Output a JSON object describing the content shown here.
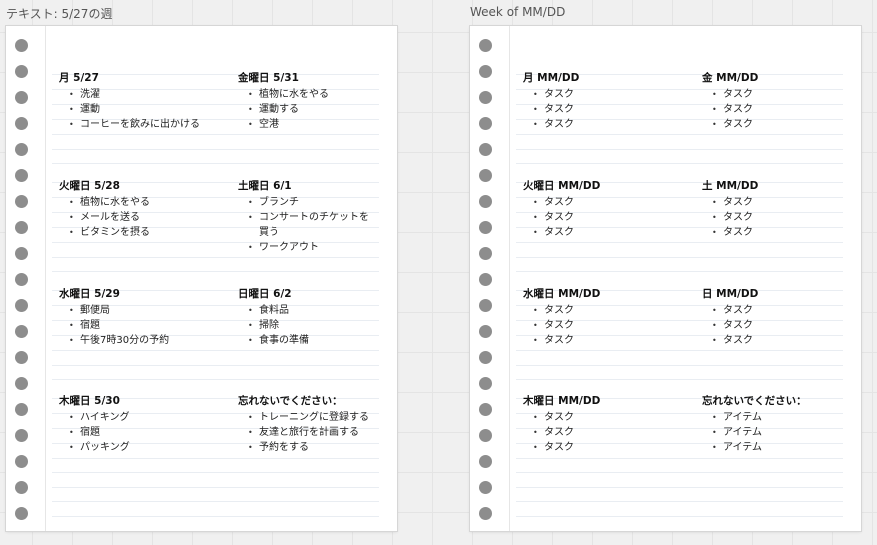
{
  "frames": [
    {
      "title": "テキスト: 5/27の週",
      "days": [
        {
          "title": "月 5/27",
          "items": [
            "洗濯",
            "運動",
            "コーヒーを飲みに出かける"
          ]
        },
        {
          "title": "金曜日 5/31",
          "items": [
            "植物に水をやる",
            "運動する",
            "空港"
          ]
        },
        {
          "title": "火曜日 5/28",
          "items": [
            "植物に水をやる",
            "メールを送る",
            "ビタミンを摂る"
          ]
        },
        {
          "title": "土曜日 6/1",
          "items": [
            "ブランチ",
            "コンサートのチケットを買う",
            "ワークアウト"
          ]
        },
        {
          "title": "水曜日 5/29",
          "items": [
            "郵便局",
            "宿題",
            "午後7時30分の予約"
          ]
        },
        {
          "title": "日曜日 6/2",
          "items": [
            "食料品",
            "掃除",
            "食事の準備"
          ]
        },
        {
          "title": "木曜日 5/30",
          "items": [
            "ハイキング",
            "宿題",
            "パッキング"
          ]
        },
        {
          "title": "忘れないでください：",
          "items": [
            "トレーニングに登録する",
            "友達と旅行を計画する",
            "予約をする"
          ]
        }
      ]
    },
    {
      "title": "Week of MM/DD",
      "days": [
        {
          "title": "月 MM/DD",
          "items": [
            "タスク",
            "タスク",
            "タスク"
          ]
        },
        {
          "title": "金 MM/DD",
          "items": [
            "タスク",
            "タスク",
            "タスク"
          ]
        },
        {
          "title": "火曜日 MM/DD",
          "items": [
            "タスク",
            "タスク",
            "タスク"
          ]
        },
        {
          "title": "土 MM/DD",
          "items": [
            "タスク",
            "タスク",
            "タスク"
          ]
        },
        {
          "title": "水曜日 MM/DD",
          "items": [
            "タスク",
            "タスク",
            "タスク"
          ]
        },
        {
          "title": "日 MM/DD",
          "items": [
            "タスク",
            "タスク",
            "タスク"
          ]
        },
        {
          "title": "木曜日 MM/DD",
          "items": [
            "タスク",
            "タスク",
            "タスク"
          ]
        },
        {
          "title": "忘れないでください：",
          "items": [
            "アイテム",
            "アイテム",
            "アイテム"
          ]
        }
      ]
    }
  ]
}
